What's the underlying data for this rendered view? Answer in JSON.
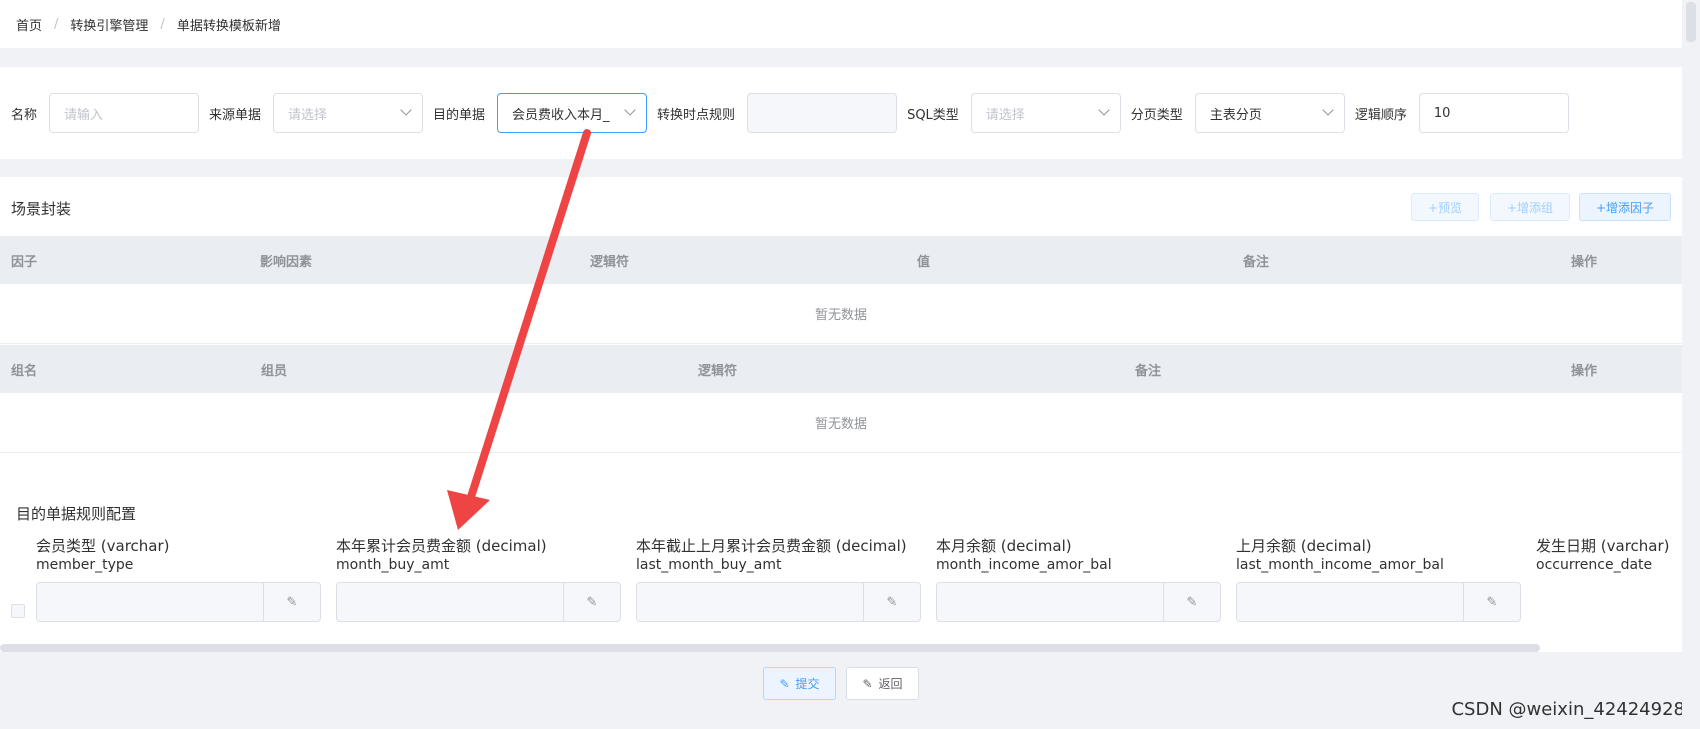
{
  "breadcrumb": {
    "items": [
      "首页",
      "转换引擎管理",
      "单据转换模板新增"
    ],
    "separator": "/"
  },
  "form": {
    "name_label": "名称",
    "name_placeholder": "请输入",
    "source_label": "来源单据",
    "source_placeholder": "请选择",
    "target_label": "目的单据",
    "target_value": "会员费收入本月_",
    "timepoint_label": "转换时点规则",
    "timepoint_value": "",
    "sql_label": "SQL类型",
    "sql_placeholder": "请选择",
    "page_label": "分页类型",
    "page_value": "主表分页",
    "order_label": "逻辑顺序",
    "order_value": "10"
  },
  "scene": {
    "title": "场景封装",
    "buttons": {
      "preview": "+预览",
      "add_group": "+增添组",
      "add_factor": "+增添因子"
    },
    "factor_table": {
      "headers": [
        "因子",
        "影响因素",
        "逻辑符",
        "值",
        "备注",
        "操作"
      ],
      "empty_text": "暂无数据"
    },
    "group_table": {
      "headers": [
        "组名",
        "组员",
        "逻辑符",
        "备注",
        "操作"
      ],
      "empty_text": "暂无数据"
    }
  },
  "rules": {
    "title": "目的单据规则配置",
    "columns": [
      {
        "label": "会员类型 (varchar)",
        "field": "member_type"
      },
      {
        "label": "本年累计会员费金额 (decimal)",
        "field": "month_buy_amt"
      },
      {
        "label": "本年截止上月累计会员费金额 (decimal)",
        "field": "last_month_buy_amt"
      },
      {
        "label": "本月余额 (decimal)",
        "field": "month_income_amor_bal"
      },
      {
        "label": "上月余额 (decimal)",
        "field": "last_month_income_amor_bal"
      },
      {
        "label": "发生日期 (varchar)",
        "field": "occurrence_date"
      }
    ]
  },
  "actions": {
    "submit": "提交",
    "back": "返回"
  },
  "credit": "CSDN @weixin_42424928",
  "colors": {
    "accent": "#409eff",
    "arrow": "#ef4444",
    "header_bg": "#eaedf1"
  }
}
